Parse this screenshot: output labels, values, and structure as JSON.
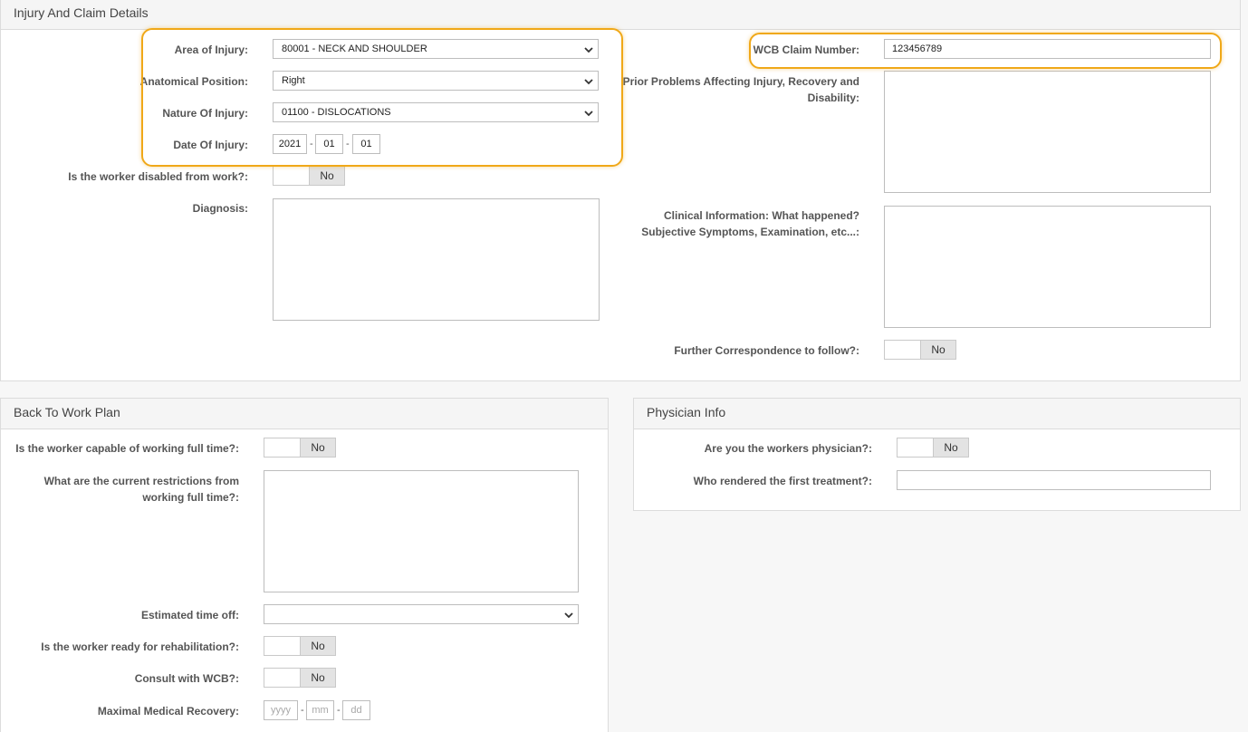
{
  "injury_panel": {
    "title": "Injury And Claim Details",
    "area_of_injury": {
      "label": "Area of Injury:",
      "value": "80001 - NECK AND SHOULDER"
    },
    "anatomical_position": {
      "label": "Anatomical Position:",
      "value": "Right"
    },
    "nature_of_injury": {
      "label": "Nature Of Injury:",
      "value": "01100 - DISLOCATIONS"
    },
    "date_of_injury": {
      "label": "Date Of Injury:",
      "year": "2021",
      "month": "01",
      "day": "01",
      "sep": "-"
    },
    "disabled_from_work": {
      "label": "Is the worker disabled from work?:",
      "value": "No"
    },
    "diagnosis": {
      "label": "Diagnosis:"
    },
    "wcb_claim_number": {
      "label": "WCB Claim Number:",
      "value": "123456789"
    },
    "prior_problems": {
      "label_line1": "Prior Problems Affecting Injury, Recovery and",
      "label_line2": "Disability:"
    },
    "clinical_information": {
      "label_line1": "Clinical Information: What happened?",
      "label_line2": "Subjective Symptoms, Examination, etc...:"
    },
    "further_correspondence": {
      "label": "Further Correspondence to follow?:",
      "value": "No"
    }
  },
  "back_to_work": {
    "title": "Back To Work Plan",
    "capable_full_time": {
      "label": "Is the worker capable of working full time?:",
      "value": "No"
    },
    "current_restrictions": {
      "label_line1": "What are the current restrictions from",
      "label_line2": "working full time?:"
    },
    "estimated_time_off": {
      "label": "Estimated time off:",
      "value": ""
    },
    "ready_for_rehab": {
      "label": "Is the worker ready for rehabilitation?:",
      "value": "No"
    },
    "consult_wcb": {
      "label": "Consult with WCB?:",
      "value": "No"
    },
    "maximal_medical_recovery": {
      "label": "Maximal Medical Recovery:",
      "year_placeholder": "yyyy",
      "month_placeholder": "mm",
      "day_placeholder": "dd",
      "sep": "-"
    }
  },
  "physician_info": {
    "title": "Physician Info",
    "workers_physician": {
      "label": "Are you the workers physician?:",
      "value": "No"
    },
    "first_treatment": {
      "label": "Who rendered the first treatment?:",
      "value": ""
    }
  },
  "colors": {
    "highlight": "#f0a818",
    "panel_header": "#f5f5f5",
    "border": "#dcdcdc",
    "toggle_off": "#e3e3e3"
  }
}
